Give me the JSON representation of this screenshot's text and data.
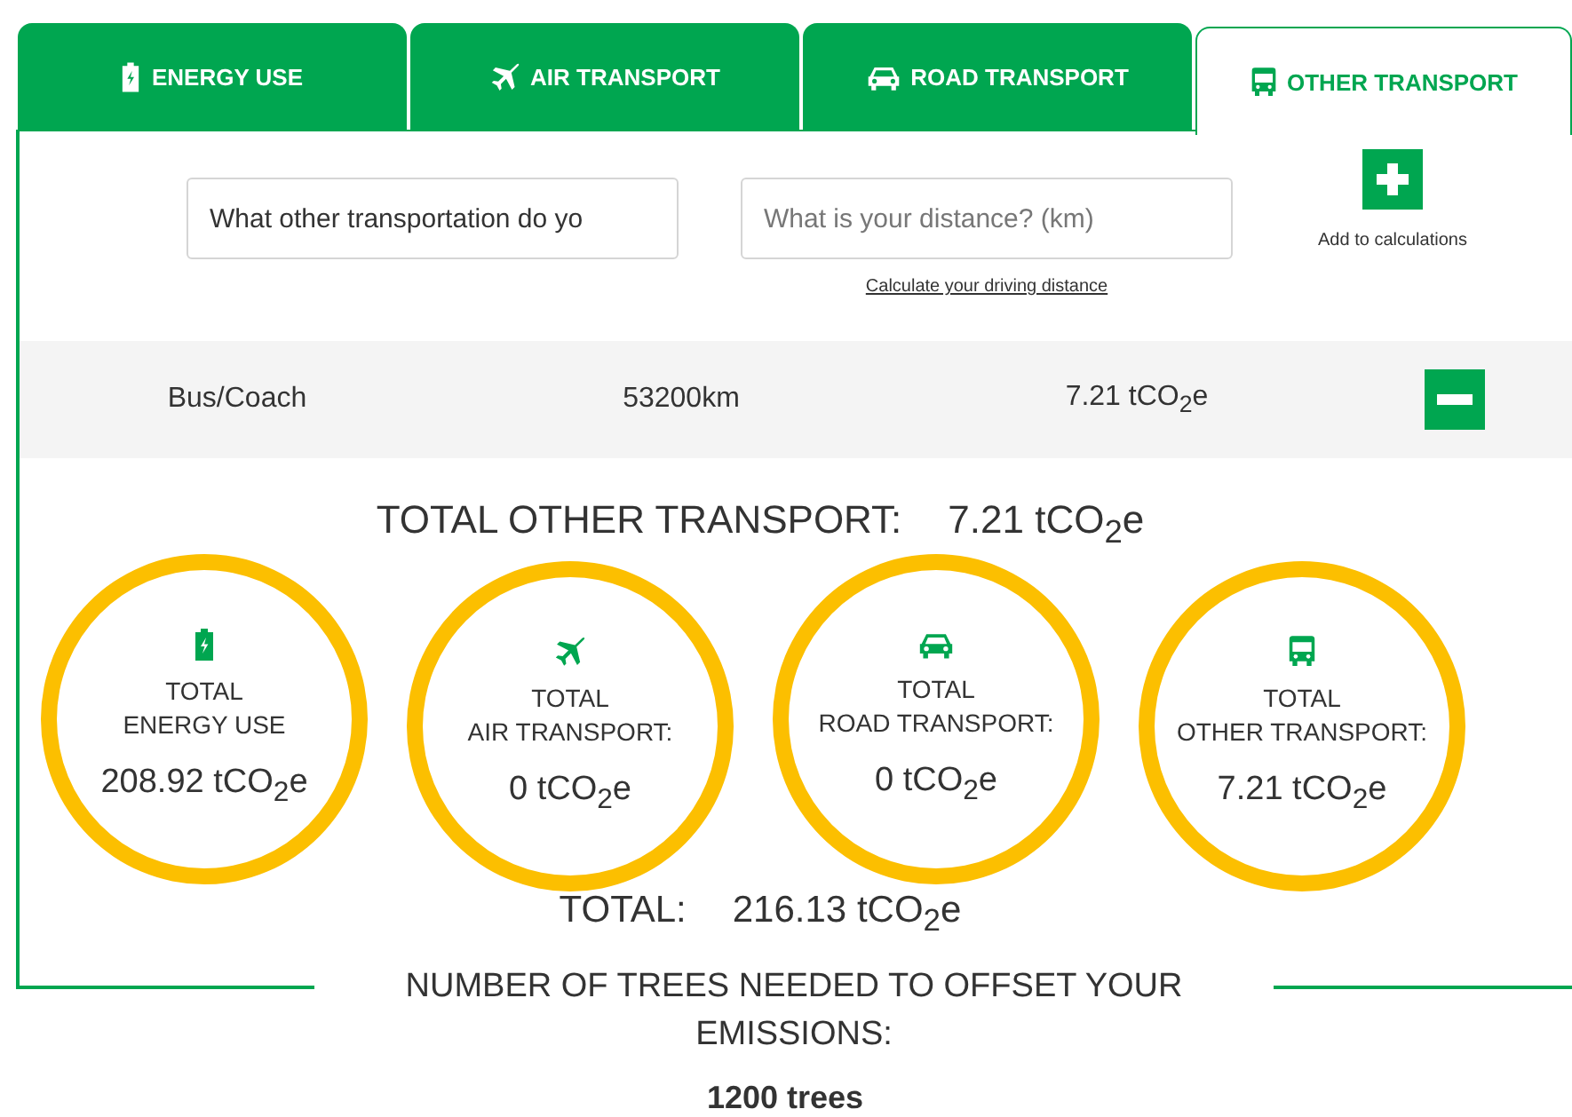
{
  "tabs": [
    {
      "label": "ENERGY USE",
      "kind": "energy",
      "selected": false
    },
    {
      "label": "AIR TRANSPORT",
      "kind": "air",
      "selected": false
    },
    {
      "label": "ROAD TRANSPORT",
      "kind": "road",
      "selected": false
    },
    {
      "label": "OTHER TRANSPORT",
      "kind": "other",
      "selected": true
    }
  ],
  "form": {
    "transport_field": {
      "value": "What other transportation do yo"
    },
    "distance_field": {
      "placeholder": "What is your distance? (km)"
    },
    "distance_link": "Calculate your driving distance",
    "add_label": "Add to calculations"
  },
  "entries": [
    {
      "type": "Bus/Coach",
      "distance": "53200km",
      "emissions": "7.21 tCO$_{2}$e"
    }
  ],
  "category_total": {
    "label": "TOTAL OTHER TRANSPORT:",
    "value": "7.21 tCO$_{2}$e"
  },
  "circles": [
    {
      "kind": "energy",
      "label": "TOTAL\nENERGY USE",
      "value": "208.92 tCO$_{2}$e"
    },
    {
      "kind": "air",
      "label": "TOTAL\nAIR TRANSPORT:",
      "value": "0 tCO$_{2}$e"
    },
    {
      "kind": "road",
      "label": "TOTAL\nROAD TRANSPORT:",
      "value": "0 tCO$_{2}$e"
    },
    {
      "kind": "other",
      "label": "TOTAL\nOTHER TRANSPORT:",
      "value": "7.21 tCO$_{2}$e"
    }
  ],
  "grand_total": {
    "label": "TOTAL:",
    "value": "216.13 tCO$_{2}$e"
  },
  "trees": {
    "heading": "NUMBER OF TREES NEEDED TO OFFSET YOUR EMISSIONS:",
    "value": "1200 trees"
  }
}
